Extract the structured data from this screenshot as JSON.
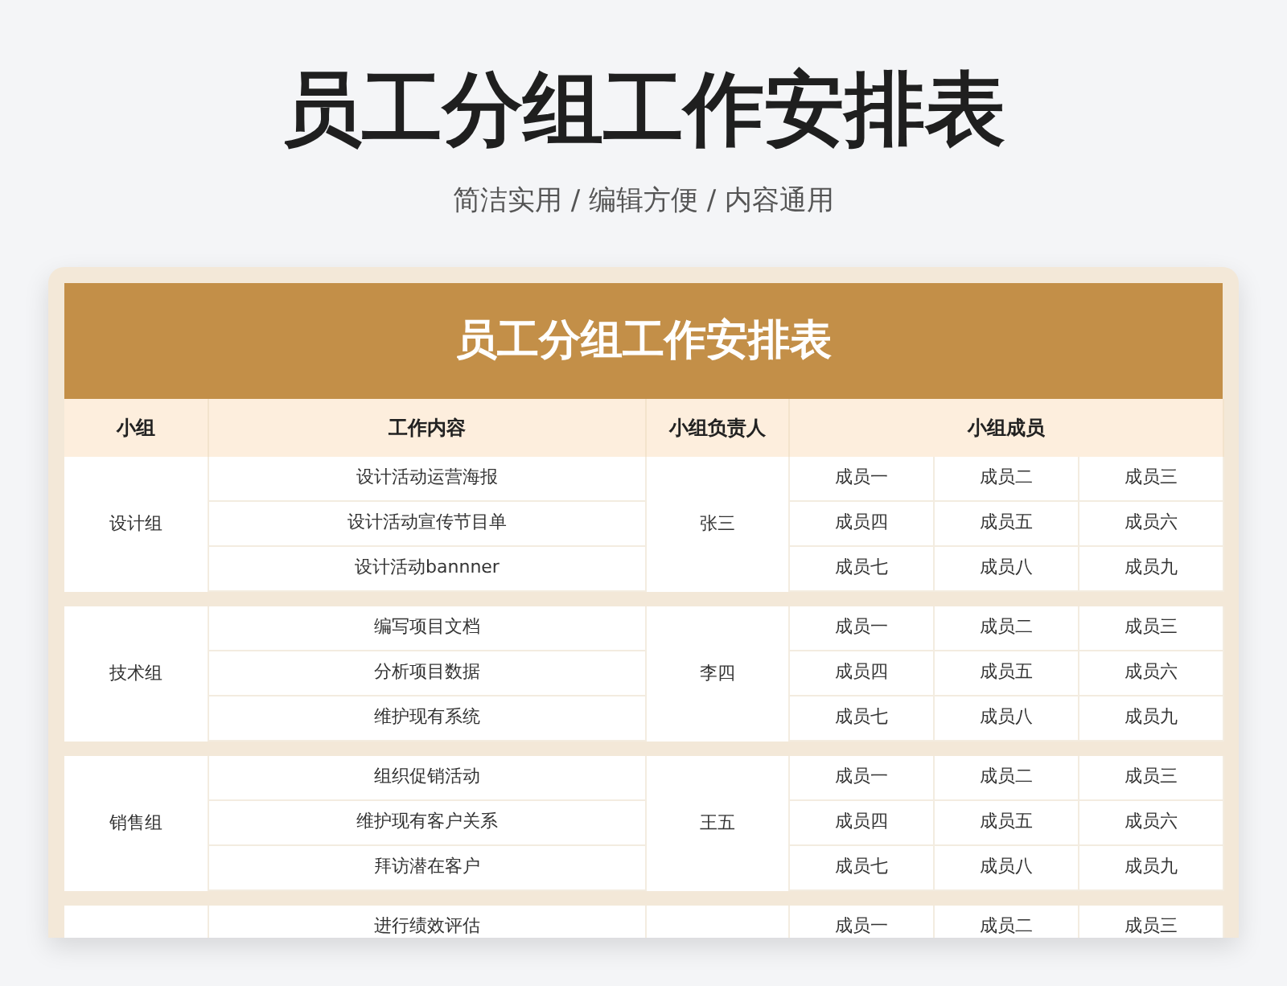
{
  "page_title": "员工分组工作安排表",
  "subtitle": "简洁实用 / 编辑方便 / 内容通用",
  "table": {
    "title": "员工分组工作安排表",
    "columns": [
      "小组",
      "工作内容",
      "小组负责人",
      "小组成员"
    ],
    "groups": [
      {
        "name": "设计组",
        "leader": "张三",
        "rows": [
          {
            "task": "设计活动运营海报",
            "members": [
              "成员一",
              "成员二",
              "成员三"
            ]
          },
          {
            "task": "设计活动宣传节目单",
            "members": [
              "成员四",
              "成员五",
              "成员六"
            ]
          },
          {
            "task": "设计活动bannner",
            "members": [
              "成员七",
              "成员八",
              "成员九"
            ]
          }
        ]
      },
      {
        "name": "技术组",
        "leader": "李四",
        "rows": [
          {
            "task": "编写项目文档",
            "members": [
              "成员一",
              "成员二",
              "成员三"
            ]
          },
          {
            "task": "分析项目数据",
            "members": [
              "成员四",
              "成员五",
              "成员六"
            ]
          },
          {
            "task": "维护现有系统",
            "members": [
              "成员七",
              "成员八",
              "成员九"
            ]
          }
        ]
      },
      {
        "name": "销售组",
        "leader": "王五",
        "rows": [
          {
            "task": "组织促销活动",
            "members": [
              "成员一",
              "成员二",
              "成员三"
            ]
          },
          {
            "task": "维护现有客户关系",
            "members": [
              "成员四",
              "成员五",
              "成员六"
            ]
          },
          {
            "task": "拜访潜在客户",
            "members": [
              "成员七",
              "成员八",
              "成员九"
            ]
          }
        ]
      },
      {
        "rows": [
          {
            "task": "进行绩效评估",
            "members": [
              "成员一",
              "成员二",
              "成员三"
            ]
          }
        ]
      }
    ]
  }
}
